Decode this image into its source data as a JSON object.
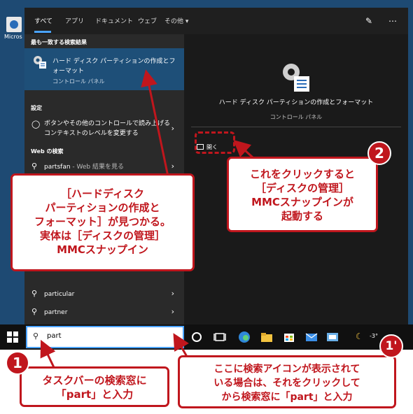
{
  "desktop": {
    "icon_label": "Micros"
  },
  "search_panel": {
    "tabs": [
      {
        "label": "すべて"
      },
      {
        "label": "アプリ"
      },
      {
        "label": "ドキュメント"
      },
      {
        "label": "ウェブ"
      },
      {
        "label": "その他 ▾"
      }
    ],
    "best_match_header": "最も一致する検索結果",
    "best_match": {
      "title": "ハード ディスク パーティションの作成とフォーマット",
      "subtitle": "コントロール パネル"
    },
    "settings_header": "設定",
    "settings_item": "ボタンやその他のコントロールで読み上げるコンテキストのレベルを変更する",
    "web_header": "Web の検索",
    "web_item": {
      "text": "partsfan",
      "suffix": " - Web 結果を見る"
    },
    "suggestions": [
      "particular",
      "partner"
    ]
  },
  "detail_pane": {
    "title": "ハード ディスク パーティションの作成とフォーマット",
    "subtitle": "コントロール パネル",
    "open_label": "開く"
  },
  "taskbar": {
    "search_value": "part",
    "clock_text": "-3°"
  },
  "callouts": {
    "main": [
      "［ハードディスク",
      "パーティションの作成と",
      "フォーマット］が見つかる。",
      "実体は［ディスクの管理］",
      "MMCスナップイン"
    ],
    "step2": [
      "これをクリックすると",
      "［ディスクの管理］",
      "MMCスナップインが",
      "起動する"
    ],
    "step1": [
      "タスクバーの検索窓に",
      "「part」と入力"
    ],
    "step1b": [
      "ここに検索アイコンが表示されて",
      "いる場合は、それをクリックして",
      "から検索窓に「part」と入力"
    ]
  },
  "badges": {
    "one": "1",
    "two": "2",
    "one_prime": "1'"
  },
  "colors": {
    "accent": "#c0161d",
    "highlight": "#1e4f78",
    "focus": "#4aa3ff"
  }
}
